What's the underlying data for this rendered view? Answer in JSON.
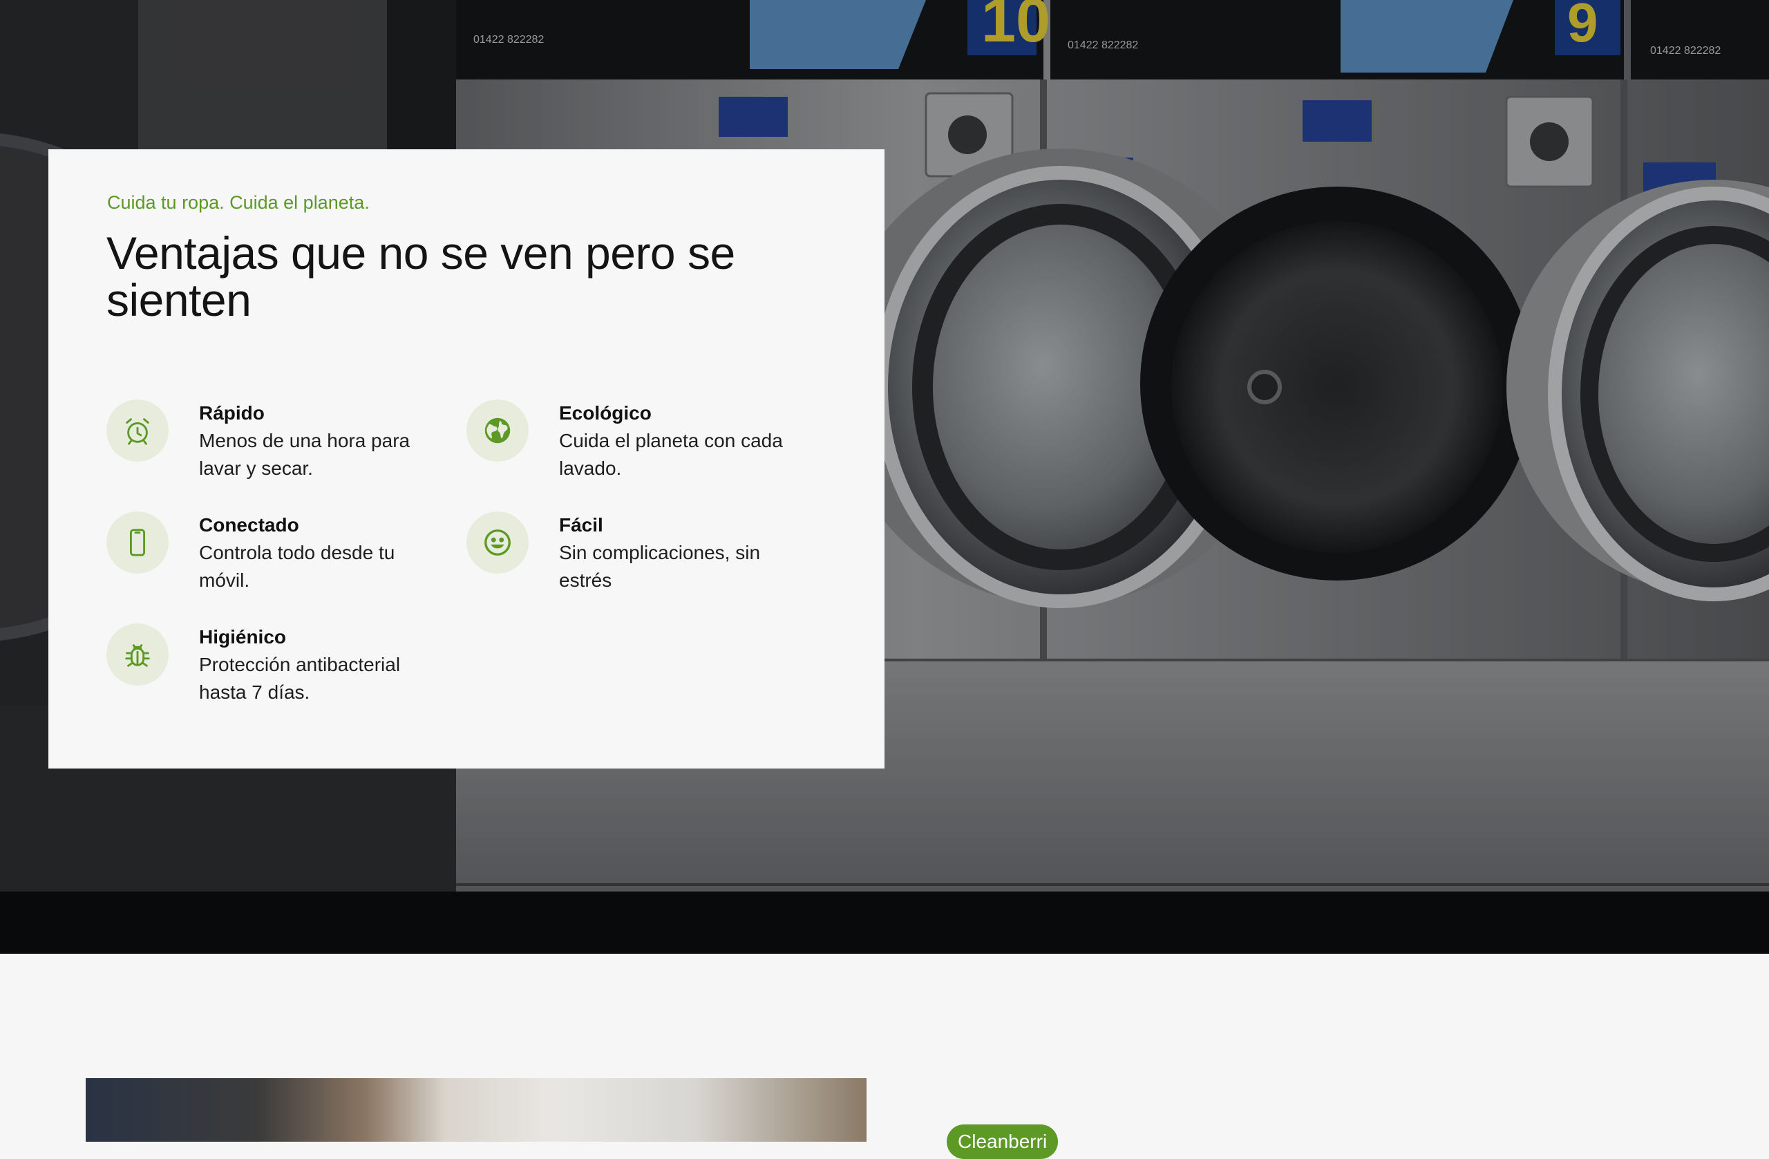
{
  "hero": {
    "image": "laundromat-washing-machines-photo"
  },
  "benefits": {
    "eyebrow": "Cuida tu ropa. Cuida el planeta.",
    "title": "Ventajas que no se ven pero se sienten",
    "items": [
      {
        "icon": "alarm-clock-icon",
        "title": "Rápido",
        "desc": "Menos de una hora para lavar y secar."
      },
      {
        "icon": "globe-icon",
        "title": "Ecológico",
        "desc": "Cuida el planeta con cada lavado."
      },
      {
        "icon": "smartphone-icon",
        "title": "Conectado",
        "desc": "Controla todo desde tu móvil."
      },
      {
        "icon": "smiley-icon",
        "title": "Fácil",
        "desc": "Sin complicaciones, sin estrés"
      },
      {
        "icon": "bug-icon",
        "title": "Higiénico",
        "desc": "Protección antibacterial hasta 7 días."
      }
    ]
  },
  "next_section": {
    "badge": "Cleanberri"
  },
  "colors": {
    "accent": "#5c9a25",
    "icon_bg": "#e7ecdd",
    "card_bg": "#f7f7f7"
  }
}
